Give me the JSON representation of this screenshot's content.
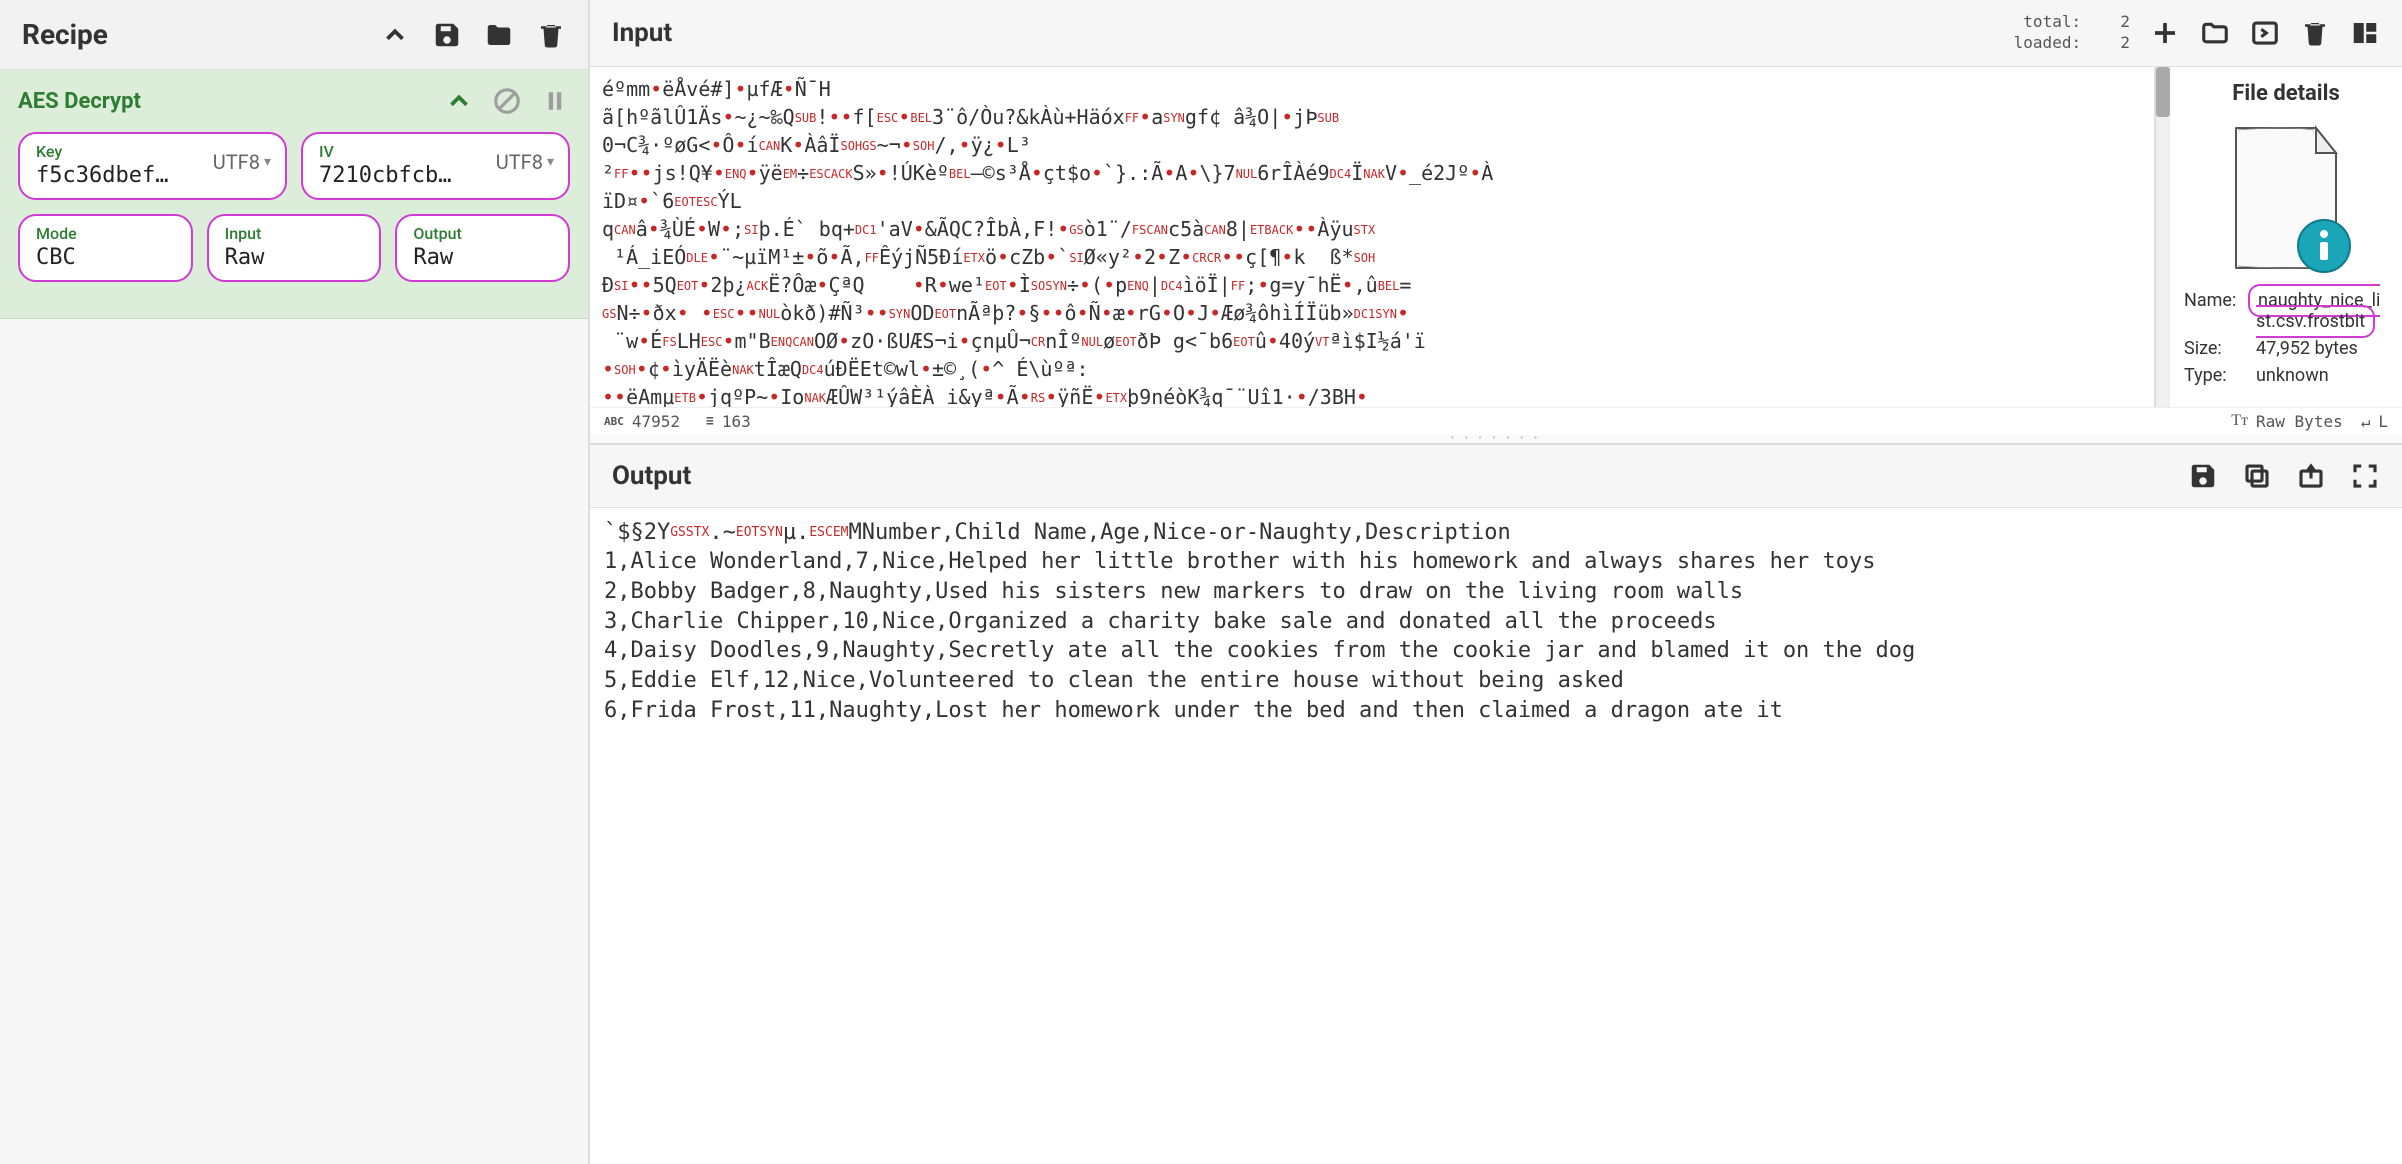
{
  "recipe": {
    "title": "Recipe",
    "operation": {
      "name": "AES Decrypt",
      "params": {
        "key": {
          "label": "Key",
          "value": "f5c36dbef…",
          "encoding": "UTF8"
        },
        "iv": {
          "label": "IV",
          "value": "7210cbfcb…",
          "encoding": "UTF8"
        },
        "mode": {
          "label": "Mode",
          "value": "CBC"
        },
        "input": {
          "label": "Input",
          "value": "Raw"
        },
        "output": {
          "label": "Output",
          "value": "Raw"
        }
      }
    }
  },
  "input": {
    "title": "Input",
    "counts": {
      "total_label": "total:",
      "total_value": "2",
      "loaded_label": "loaded:",
      "loaded_value": "2"
    },
    "file_details": {
      "title": "File details",
      "name_label": "Name:",
      "name_value": "naughty_nice_list.csv.frostbit",
      "size_label": "Size:",
      "size_value": "47,952 bytes",
      "type_label": "Type:",
      "type_value": "unknown"
    },
    "status": {
      "chars": "47952",
      "lines": "163",
      "mode_label": "Raw Bytes",
      "wrap_label": "L"
    }
  },
  "output": {
    "title": "Output"
  }
}
